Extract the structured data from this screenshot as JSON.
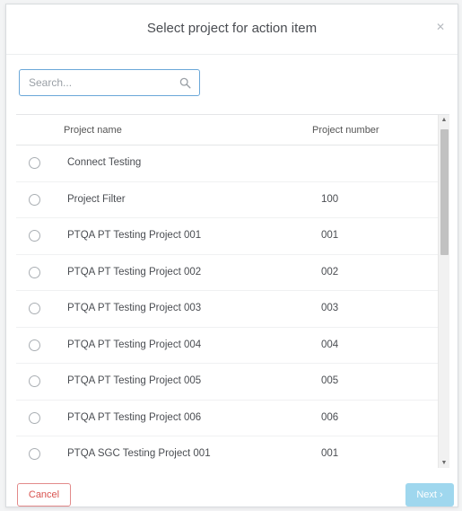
{
  "modal": {
    "title": "Select project for action item",
    "close_icon": "close-icon"
  },
  "search": {
    "placeholder": "Search...",
    "value": "",
    "icon": "search-icon"
  },
  "table": {
    "columns": [
      "Project name",
      "Project number"
    ],
    "rows": [
      {
        "name": "Connect Testing",
        "number": ""
      },
      {
        "name": "Project Filter",
        "number": "100"
      },
      {
        "name": "PTQA PT Testing Project 001",
        "number": "001"
      },
      {
        "name": "PTQA PT Testing Project 002",
        "number": "002"
      },
      {
        "name": "PTQA PT Testing Project 003",
        "number": "003"
      },
      {
        "name": "PTQA PT Testing Project 004",
        "number": "004"
      },
      {
        "name": "PTQA PT Testing Project 005",
        "number": "005"
      },
      {
        "name": "PTQA PT Testing Project 006",
        "number": "006"
      },
      {
        "name": "PTQA SGC Testing Project 001",
        "number": "001"
      }
    ]
  },
  "footer": {
    "cancel_label": "Cancel",
    "next_label": "Next ›"
  },
  "colors": {
    "accent": "#6aa7d8",
    "cancel": "#d9534f",
    "next_disabled": "#9fd7ee"
  }
}
